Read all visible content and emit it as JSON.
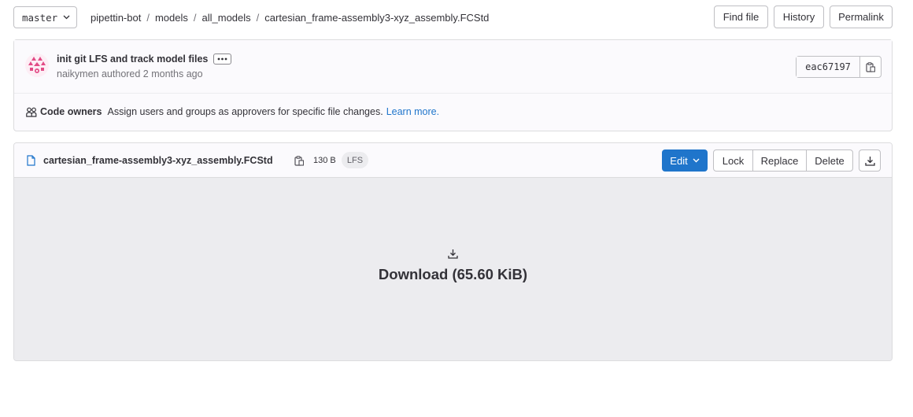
{
  "branch": {
    "name": "master"
  },
  "breadcrumb": [
    "pipettin-bot",
    "models",
    "all_models",
    "cartesian_frame-assembly3-xyz_assembly.FCStd"
  ],
  "header_actions": {
    "find_file": "Find file",
    "history": "History",
    "permalink": "Permalink"
  },
  "commit": {
    "title": "init git LFS and track model files",
    "author": "naikymen",
    "authored_text": "authored 2 months ago",
    "sha": "eac67197"
  },
  "code_owners": {
    "label": "Code owners",
    "text": "Assign users and groups as approvers for specific file changes.",
    "link": "Learn more."
  },
  "file": {
    "name": "cartesian_frame-assembly3-xyz_assembly.FCStd",
    "size": "130 B",
    "badge": "LFS",
    "actions": {
      "edit": "Edit",
      "lock": "Lock",
      "replace": "Replace",
      "delete": "Delete"
    },
    "download_label": "Download (65.60 KiB)"
  },
  "colors": {
    "primary": "#1f75cb",
    "link": "#1f75cb",
    "avatar": "#e24c86",
    "viewer_bg": "#ececef"
  }
}
